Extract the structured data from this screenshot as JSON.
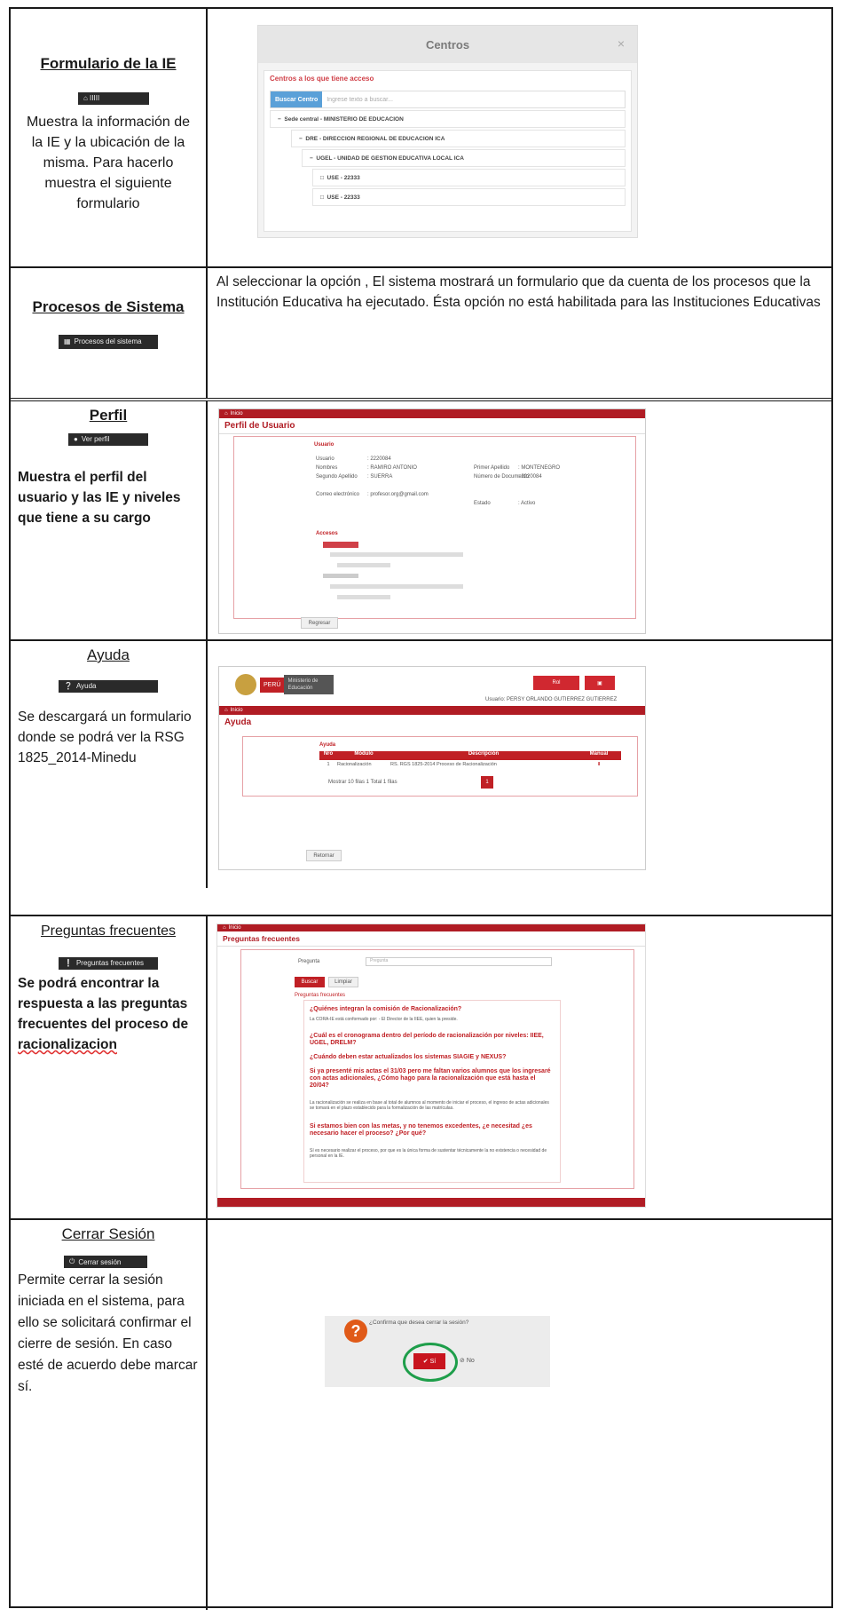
{
  "rows": {
    "ie": {
      "title": "Formulario de la IE",
      "button_label": "⌂ IIIII",
      "description": "Muestra la información de la IE y la ubicación de la misma. Para hacerlo muestra el siguiente formulario"
    },
    "procesos": {
      "title": "Procesos de Sistema",
      "button_label": "Procesos del sistema",
      "description": "Al seleccionar la opción , El sistema mostrará un formulario que da cuenta de los procesos que la Institución Educativa ha ejecutado. Ésta opción no está  habilitada para las Instituciones Educativas"
    },
    "perfil": {
      "title": "Perfil",
      "button_label": "Ver perfil",
      "description": "Muestra el perfil del usuario y las IE y niveles que tiene a su cargo"
    },
    "ayuda": {
      "title": "Ayuda",
      "button_label": "Ayuda",
      "description": "Se descargará un formulario donde se podrá ver la RSG 1825_2014-Minedu"
    },
    "faq": {
      "title": "Preguntas frecuentes",
      "button_label": "Preguntas frecuentes",
      "description_part1": "Se podrá encontrar la respuesta a las preguntas frecuentes del proceso de ",
      "description_part2": "racionalizacion"
    },
    "logout": {
      "title": "Cerrar Sesión",
      "button_label": "Cerrar sesión",
      "description": "Permite cerrar la sesión iniciada en el sistema, para ello se solicitará confirmar el cierre de sesión. En caso esté de acuerdo debe marcar sí."
    }
  },
  "centros": {
    "modal_title": "Centros",
    "close": "×",
    "section_label": "Centros a los que tiene acceso",
    "search_button": "Buscar Centro",
    "search_placeholder": "Ingrese texto a buscar...",
    "tree": [
      "Sede central - MINISTERIO DE EDUCACION",
      "DRE - DIRECCION REGIONAL DE EDUCACION ICA",
      "UGEL - UNIDAD DE GESTION EDUCATIVA LOCAL ICA",
      "USE - 22333",
      "USE - 22333"
    ]
  },
  "perfil_screen": {
    "breadcrumb": "Inicio",
    "page_title": "Perfil de Usuario",
    "usuario_label": "Usuario",
    "fields": [
      {
        "label": "Usuario",
        "value": ": 2220084"
      },
      {
        "label": "Nombres",
        "value": ": RAMIRO ANTONIO"
      },
      {
        "label": "Segundo Apellido",
        "value": ": SUERRA"
      },
      {
        "label": "Correo electrónico",
        "value": ": profesor.org@gmail.com"
      },
      {
        "label": "Primer Apellido",
        "value": ": MONTENEGRO"
      },
      {
        "label": "Número de Documento",
        "value": ": 2220084"
      },
      {
        "label": "Estado",
        "value": ": Activo"
      }
    ],
    "accesos_label": "Accesos",
    "regresar": "Regresar"
  },
  "ayuda_screen": {
    "brand": "PERÚ",
    "ministry": "Ministerio de Educación",
    "rol_button": "Rol",
    "user_line": "Usuario: PERSY ORLANDO GUTIERREZ GUTIERREZ",
    "breadcrumb": "Inicio",
    "page_title": "Ayuda",
    "panel_title": "Ayuda",
    "headers": [
      "Nro",
      "Módulo",
      "Descripción",
      "Manual"
    ],
    "row": [
      "1",
      "Racionalización",
      "RS. RGS 1825-2014 Proceso de Racionalización",
      "⬇"
    ],
    "paging": "Mostrar   10 filas      1   Total 1 filas",
    "page_num": "1",
    "regresar": "Retornar"
  },
  "faq_screen": {
    "breadcrumb": "Inicio",
    "page_title": "Preguntas frecuentes",
    "pregunta_label": "Pregunta",
    "pregunta_placeholder": "Pregunta",
    "buscar": "Buscar",
    "limpiar": "Limpiar",
    "list_label": "Preguntas frecuentes",
    "questions": [
      "¿Quiénes integran la comisión de Racionalización?",
      "¿Cuál es el cronograma dentro del período de racionalización por niveles: IIEE, UGEL, DRELM?",
      "¿Cuándo deben estar actualizados los sistemas SIAGIE y NEXUS?",
      "Si ya presenté mis actas el 31/03 pero me faltan varios alumnos que los ingresaré con actas adicionales, ¿Cómo hago para la racionalización que está hasta el 20/04?",
      "Si estamos bien con las metas, y no tenemos excedentes, ¿e necesitad ¿es necesario hacer el proceso? ¿Por qué?"
    ],
    "answer1": "La CORA-IE está conformado por: - El Director de la IIEE, quien la preside.",
    "answer4": "La racionalización se realiza en base al total de alumnos al momento de iniciar el proceso, el ingreso de actas adicionales se tomará en el plazo establecido para la formalización de las matrículas.",
    "answer5": "Sí es necesario realizar el proceso, por que es la única forma de sustentar técnicamente la no existencia o necesidad de personal en la IE."
  },
  "logout_screen": {
    "question": "¿Confirma que desea cerrar la sesión?",
    "yes": "Sí",
    "no": "No"
  }
}
